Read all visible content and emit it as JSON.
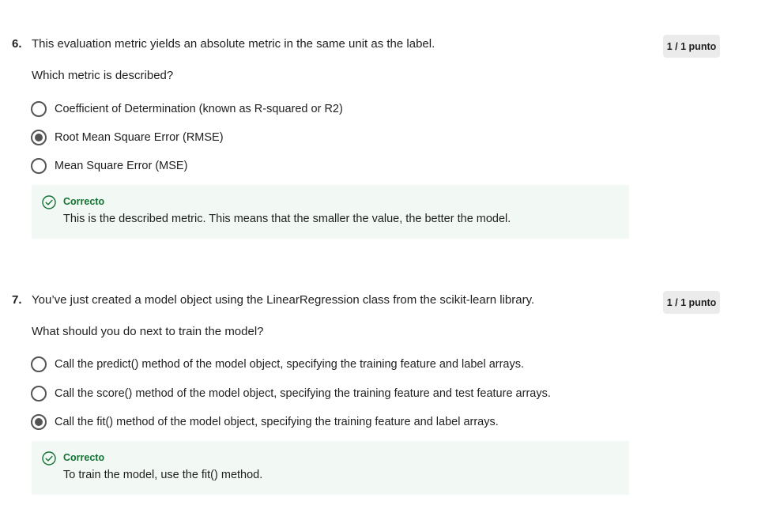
{
  "questions": [
    {
      "number": "6.",
      "prompt": "This evaluation metric yields an absolute metric in the same unit as the label.",
      "subprompt": "Which metric is described?",
      "score": "1 / 1 punto",
      "options": [
        {
          "label": "Coefficient of Determination (known as R-squared or R2)",
          "selected": false
        },
        {
          "label": "Root Mean Square Error (RMSE)",
          "selected": true
        },
        {
          "label": "Mean Square Error (MSE)",
          "selected": false
        }
      ],
      "feedback": {
        "title": "Correcto",
        "text": "This is the described metric. This means that the smaller the value, the better the model."
      }
    },
    {
      "number": "7.",
      "prompt": "You’ve just created a model object using the LinearRegression class from the scikit-learn library.",
      "subprompt": "What should you do next to train the model?",
      "score": "1 / 1 punto",
      "options": [
        {
          "label": "Call the predict() method of the model object, specifying the training feature and label arrays.",
          "selected": false
        },
        {
          "label": "Call the score() method of the model object, specifying the training feature and test feature arrays.",
          "selected": false
        },
        {
          "label": "Call the fit() method of the model object, specifying the training feature and label arrays.",
          "selected": true
        }
      ],
      "feedback": {
        "title": "Correcto",
        "text": "To train the model, use the fit() method."
      }
    }
  ],
  "colors": {
    "correct_green": "#137333",
    "feedback_bg": "#f2f8f4",
    "badge_bg": "#ebebeb",
    "radio_border": "#545454"
  },
  "icons": {
    "feedback": "check-circle-icon"
  }
}
